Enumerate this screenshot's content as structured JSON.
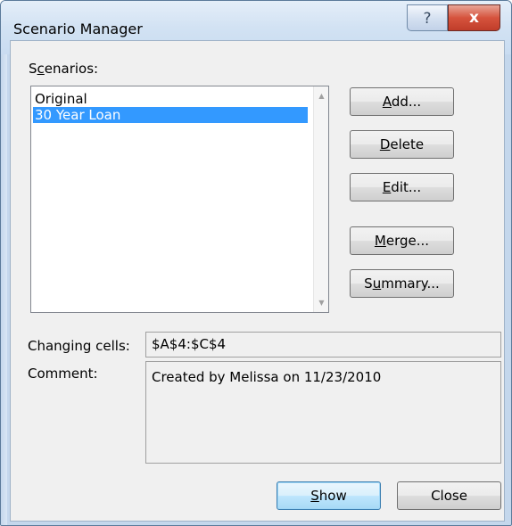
{
  "window": {
    "title": "Scenario Manager",
    "help_glyph": "?",
    "close_glyph": "x"
  },
  "scenarios": {
    "label_pre": "S",
    "label_access": "c",
    "label_post": "enarios:",
    "items": [
      {
        "label": "Original",
        "selected": false
      },
      {
        "label": "30 Year Loan",
        "selected": true
      }
    ]
  },
  "buttons": {
    "add": {
      "access": "A",
      "rest": "dd..."
    },
    "delete": {
      "access": "D",
      "rest": "elete"
    },
    "edit": {
      "access": "E",
      "rest": "dit..."
    },
    "merge": {
      "access": "M",
      "rest": "erge..."
    },
    "summary": {
      "pre": "S",
      "access": "u",
      "rest": "mmary..."
    },
    "show": {
      "access": "S",
      "rest": "how"
    },
    "close": {
      "label": "Close"
    }
  },
  "changing_cells": {
    "label": "Changing cells:",
    "value": "$A$4:$C$4"
  },
  "comment": {
    "label": "Comment:",
    "value": "Created by Melissa on 11/23/2010"
  },
  "colors": {
    "selection": "#3399ff",
    "close_button": "#c9432f",
    "title_bar": "#d2e2f3"
  }
}
